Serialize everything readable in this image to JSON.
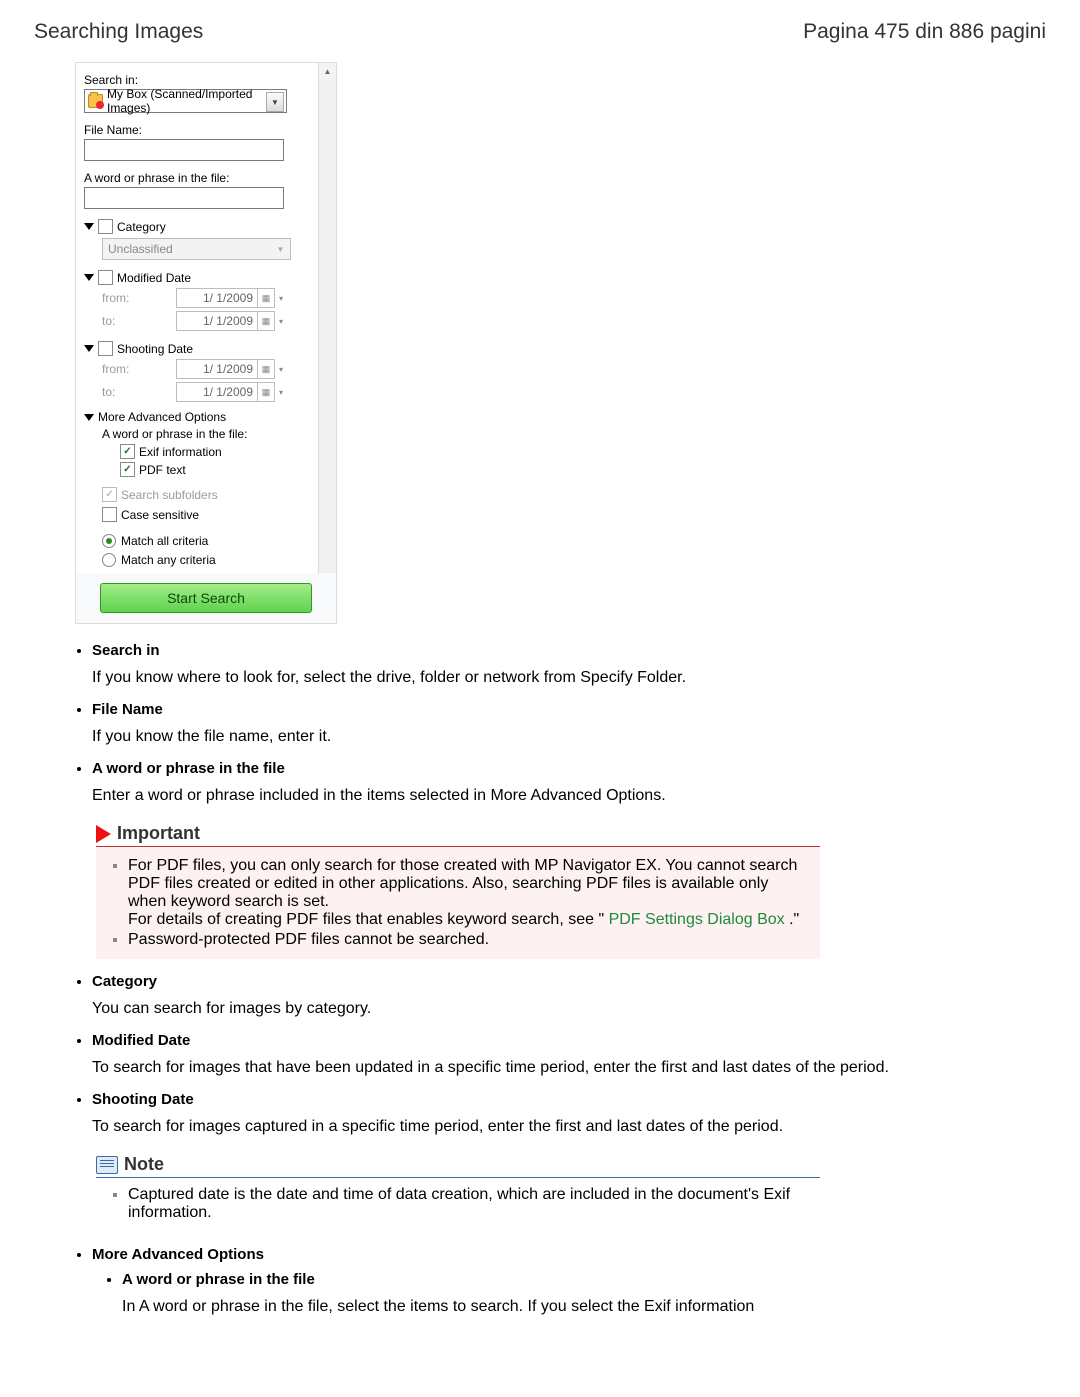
{
  "header": {
    "title_left": "Searching Images",
    "title_right": "Pagina 475 din 886 pagini"
  },
  "dialog": {
    "search_in_label": "Search in:",
    "search_in_value": "My Box (Scanned/Imported Images)",
    "file_name_label": "File Name:",
    "file_name_value": "",
    "phrase_label": "A word or phrase in the file:",
    "phrase_value": "",
    "category_label": "Category",
    "category_value": "Unclassified",
    "modified_label": "Modified Date",
    "shooting_label": "Shooting Date",
    "from_label": "from:",
    "to_label": "to:",
    "date_value": "1/  1/2009",
    "adv_label": "More Advanced Options",
    "adv_phrase_label": "A word or phrase in the file:",
    "exif_label": "Exif information",
    "pdf_label": "PDF text",
    "search_sub_label": "Search subfolders",
    "case_label": "Case sensitive",
    "match_all_label": "Match all criteria",
    "match_any_label": "Match any criteria",
    "start_button": "Start Search"
  },
  "bullets": {
    "search_in": {
      "title": "Search in",
      "text": "If you know where to look for, select the drive, folder or network from Specify Folder."
    },
    "file_name": {
      "title": "File Name",
      "text": "If you know the file name, enter it."
    },
    "phrase": {
      "title": "A word or phrase in the file",
      "text": "Enter a word or phrase included in the items selected in More Advanced Options."
    },
    "category": {
      "title": "Category",
      "text": "You can search for images by category."
    },
    "modified": {
      "title": "Modified Date",
      "text": "To search for images that have been updated in a specific time period, enter the first and last dates of the period."
    },
    "shooting": {
      "title": "Shooting Date",
      "text": "To search for images captured in a specific time period, enter the first and last dates of the period."
    },
    "adv_options": {
      "title": "More Advanced Options",
      "sub_phrase_title": "A word or phrase in the file",
      "sub_phrase_text": "In A word or phrase in the file, select the items to search. If you select the Exif information"
    }
  },
  "important": {
    "heading": "Important",
    "p1a": "For PDF files, you can only search for those created with MP Navigator EX. You cannot search PDF files created or edited in other applications. Also, searching PDF files is available only when keyword search is set.",
    "p1b_prefix": "For details of creating PDF files that enables keyword search, see \"",
    "p1b_link": "PDF Settings Dialog Box",
    "p1b_suffix": ".\"",
    "p2": "Password-protected PDF files cannot be searched."
  },
  "note": {
    "heading": "Note",
    "p1": "Captured date is the date and time of data creation, which are included in the document's Exif information."
  }
}
